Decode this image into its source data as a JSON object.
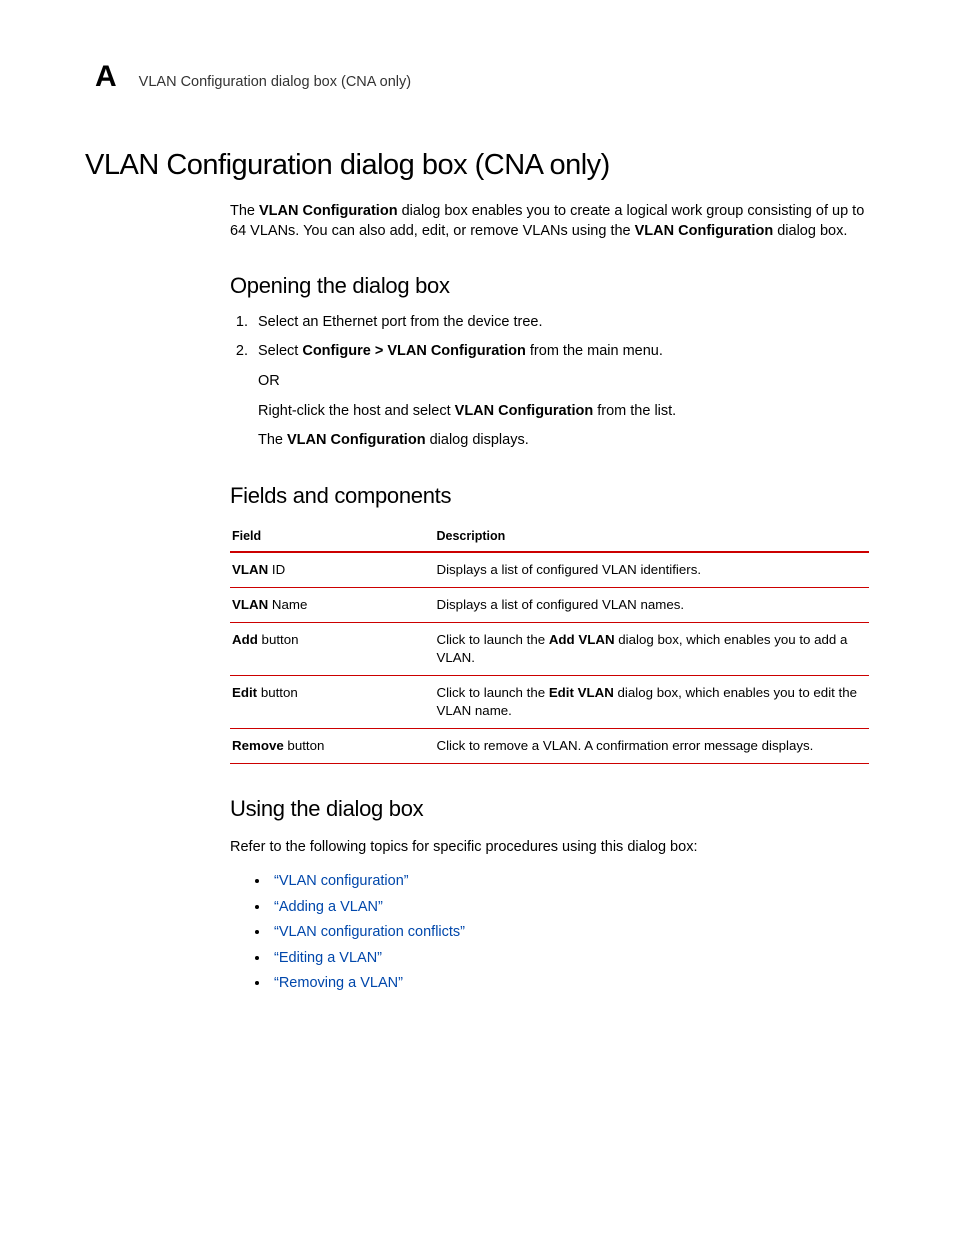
{
  "header": {
    "appendix": "A",
    "running_head": "VLAN Configuration dialog box (CNA only)"
  },
  "title": "VLAN Configuration dialog box (CNA only)",
  "intro": {
    "pre1": "The ",
    "bold1": "VLAN Configuration",
    "mid1": " dialog box enables you to create a logical work group consisting of up to 64 VLANs. You can also add, edit, or remove VLANs using the ",
    "bold2": "VLAN Configuration",
    "post1": " dialog box."
  },
  "opening": {
    "heading": "Opening the dialog box",
    "step1": "Select an Ethernet port from the device tree.",
    "step2_pre": "Select ",
    "step2_bold": "Configure > VLAN Configuration",
    "step2_post": " from the main menu.",
    "or": "OR",
    "alt_pre": "Right-click the host and select ",
    "alt_bold": "VLAN Configuration",
    "alt_post": " from the list.",
    "result_pre": "The ",
    "result_bold": "VLAN Configuration",
    "result_post": " dialog displays."
  },
  "fields": {
    "heading": "Fields and components",
    "col1": "Field",
    "col2": "Description",
    "rows": [
      {
        "f_bold": "VLAN",
        "f_rest": " ID",
        "d_pre": "Displays a list of configured VLAN identifiers.",
        "d_bold": "",
        "d_post": ""
      },
      {
        "f_bold": "VLAN",
        "f_rest": " Name",
        "d_pre": "Displays a list of configured VLAN names.",
        "d_bold": "",
        "d_post": ""
      },
      {
        "f_bold": "Add",
        "f_rest": " button",
        "d_pre": "Click to launch the ",
        "d_bold": "Add VLAN",
        "d_post": " dialog box, which enables you to add a VLAN."
      },
      {
        "f_bold": "Edit",
        "f_rest": " button",
        "d_pre": "Click to launch the ",
        "d_bold": "Edit VLAN",
        "d_post": " dialog box, which enables you to edit the VLAN name."
      },
      {
        "f_bold": "Remove",
        "f_rest": " button",
        "d_pre": "Click to remove a VLAN. A confirmation error message displays.",
        "d_bold": "",
        "d_post": ""
      }
    ]
  },
  "using": {
    "heading": "Using the dialog box",
    "intro": "Refer to the following topics for specific procedures using this dialog box:",
    "links": [
      "“VLAN configuration”",
      "“Adding a VLAN”",
      "“VLAN configuration conflicts”",
      "“Editing a VLAN”",
      "“Removing a VLAN”"
    ]
  }
}
